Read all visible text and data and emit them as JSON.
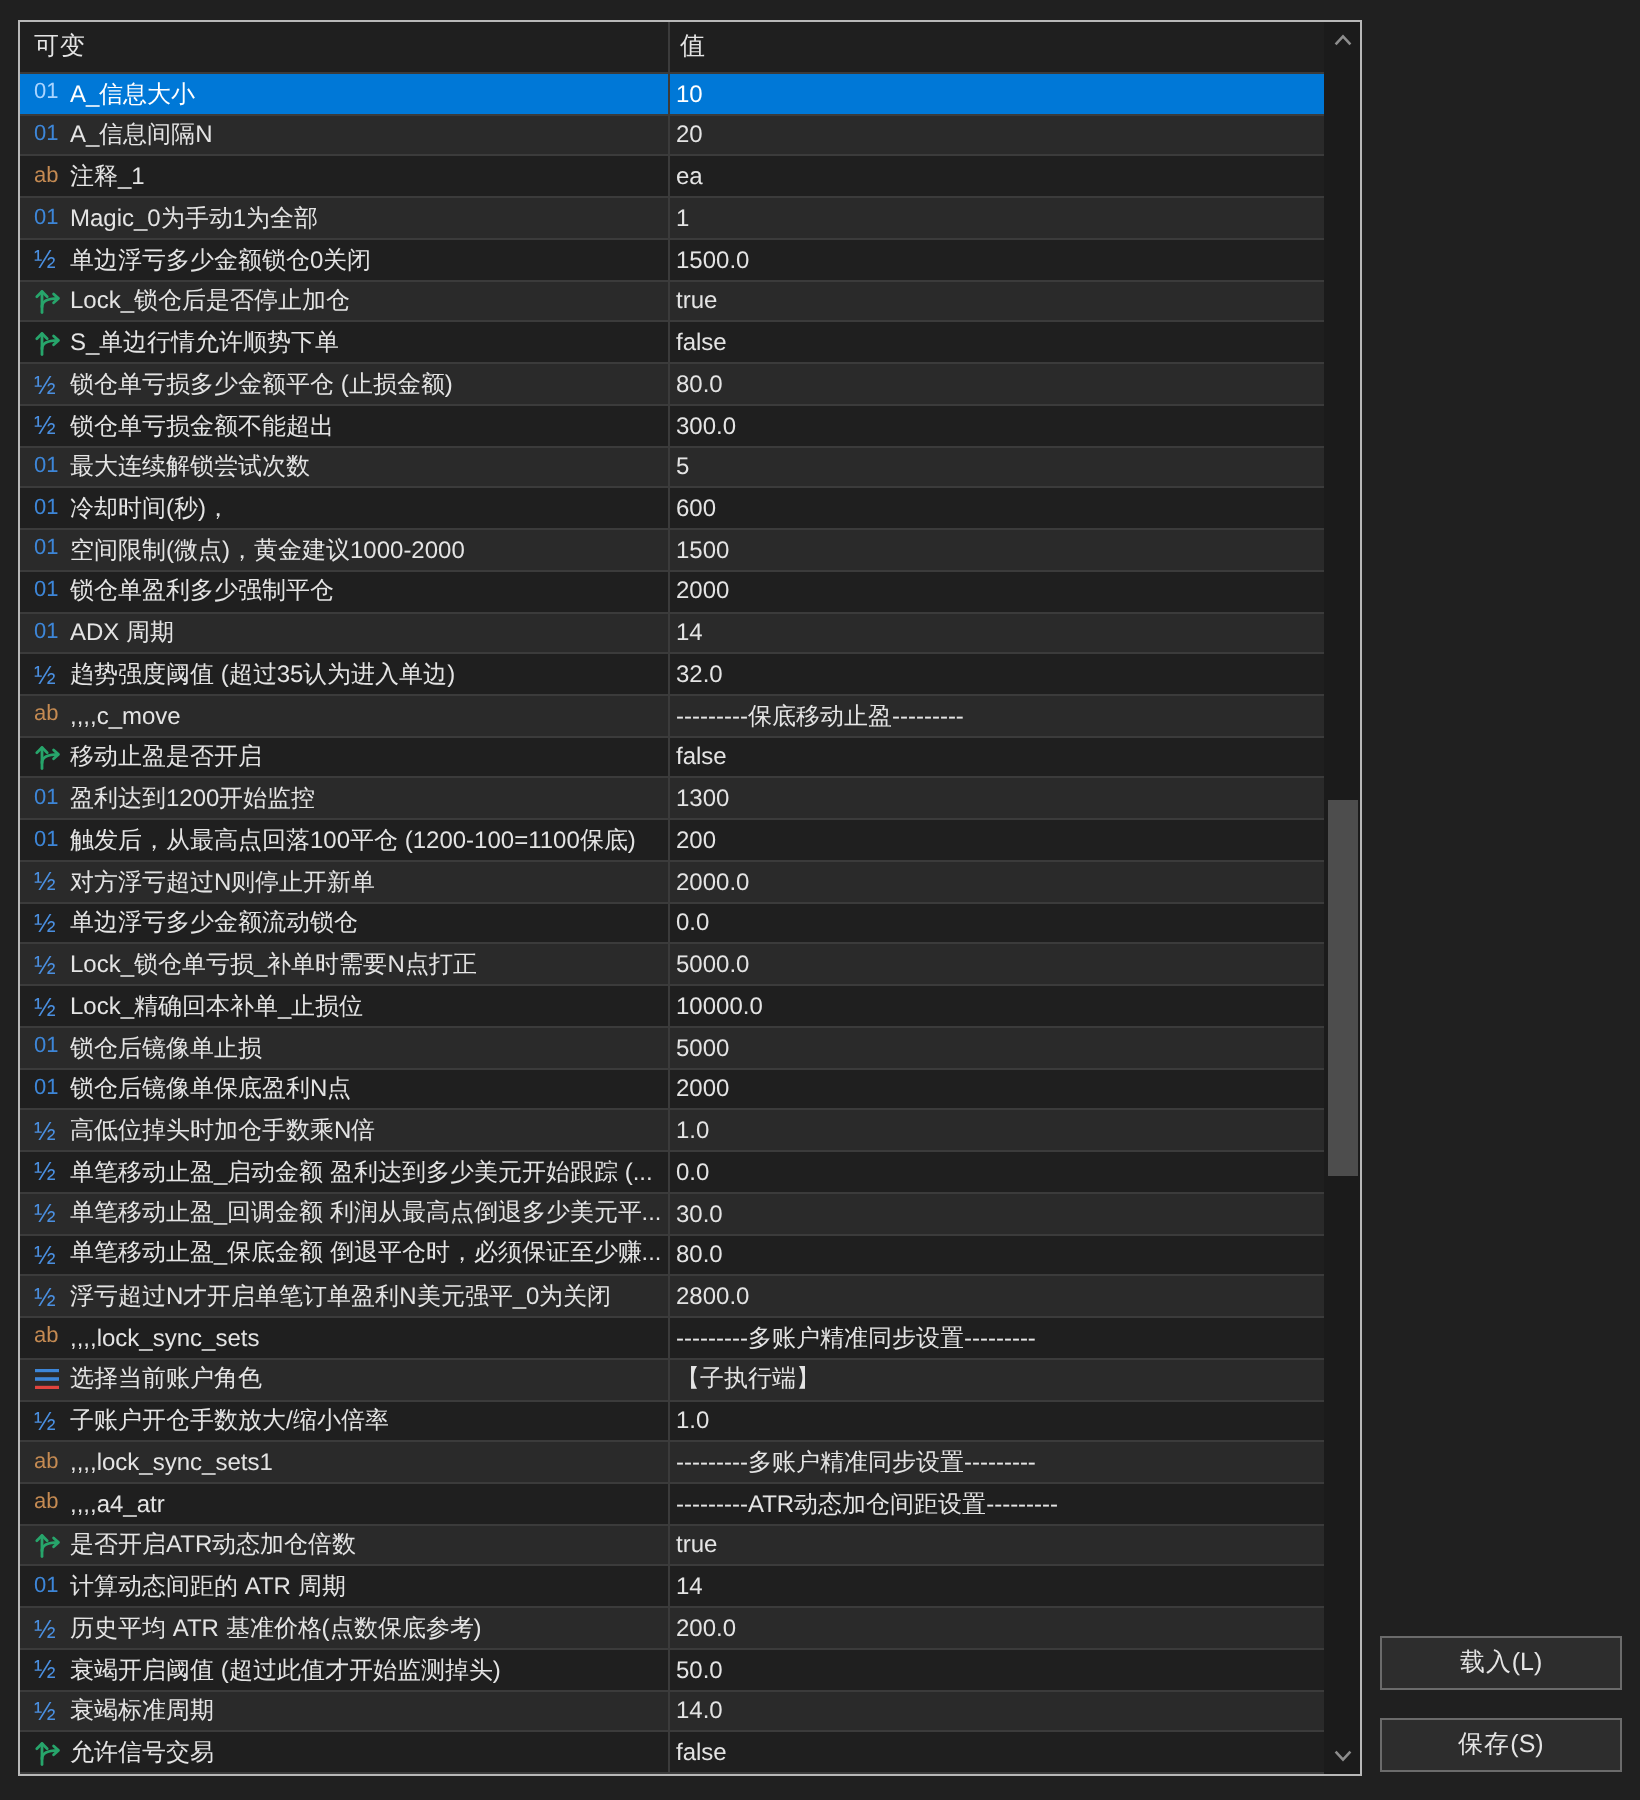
{
  "table": {
    "columns": [
      "可变",
      "值"
    ],
    "rows": [
      {
        "kind": "int",
        "icon": "01",
        "name": "A_信息大小",
        "value": "10",
        "selected": true
      },
      {
        "kind": "int",
        "icon": "01",
        "name": "A_信息间隔N",
        "value": "20",
        "selected": false
      },
      {
        "kind": "string",
        "icon": "ab",
        "name": "注释_1",
        "value": "ea",
        "selected": false
      },
      {
        "kind": "int",
        "icon": "01",
        "name": "Magic_0为手动1为全部",
        "value": "1",
        "selected": false
      },
      {
        "kind": "double",
        "icon": "½",
        "name": "单边浮亏多少金额锁仓0关闭",
        "value": "1500.0",
        "selected": false
      },
      {
        "kind": "bool",
        "name": "Lock_锁仓后是否停止加仓",
        "value": "true",
        "selected": false
      },
      {
        "kind": "bool",
        "name": "S_单边行情允许顺势下单",
        "value": "false",
        "selected": false
      },
      {
        "kind": "double",
        "icon": "½",
        "name": "锁仓单亏损多少金额平仓 (止损金额)",
        "value": "80.0",
        "selected": false
      },
      {
        "kind": "double",
        "icon": "½",
        "name": "锁仓单亏损金额不能超出",
        "value": "300.0",
        "selected": false
      },
      {
        "kind": "int",
        "icon": "01",
        "name": "最大连续解锁尝试次数",
        "value": "5",
        "selected": false
      },
      {
        "kind": "int",
        "icon": "01",
        "name": "冷却时间(秒)，",
        "value": "600",
        "selected": false
      },
      {
        "kind": "int",
        "icon": "01",
        "name": "空间限制(微点)，黄金建议1000-2000",
        "value": "1500",
        "selected": false
      },
      {
        "kind": "int",
        "icon": "01",
        "name": "锁仓单盈利多少强制平仓",
        "value": "2000",
        "selected": false
      },
      {
        "kind": "int",
        "icon": "01",
        "name": "ADX 周期",
        "value": "14",
        "selected": false
      },
      {
        "kind": "double",
        "icon": "½",
        "name": "趋势强度阈值 (超过35认为进入单边)",
        "value": "32.0",
        "selected": false
      },
      {
        "kind": "string",
        "icon": "ab",
        "name": ",,,,c_move",
        "value": "---------保底移动止盈---------",
        "selected": false
      },
      {
        "kind": "bool",
        "name": "移动止盈是否开启",
        "value": "false",
        "selected": false
      },
      {
        "kind": "int",
        "icon": "01",
        "name": "盈利达到1200开始监控",
        "value": "1300",
        "selected": false
      },
      {
        "kind": "int",
        "icon": "01",
        "name": "触发后，从最高点回落100平仓 (1200-100=1100保底)",
        "value": "200",
        "selected": false
      },
      {
        "kind": "double",
        "icon": "½",
        "name": "对方浮亏超过N则停止开新单",
        "value": "2000.0",
        "selected": false
      },
      {
        "kind": "double",
        "icon": "½",
        "name": "单边浮亏多少金额流动锁仓",
        "value": "0.0",
        "selected": false
      },
      {
        "kind": "double",
        "icon": "½",
        "name": "Lock_锁仓单亏损_补单时需要N点打正",
        "value": "5000.0",
        "selected": false
      },
      {
        "kind": "double",
        "icon": "½",
        "name": "Lock_精确回本补单_止损位",
        "value": "10000.0",
        "selected": false
      },
      {
        "kind": "int",
        "icon": "01",
        "name": "锁仓后镜像单止损",
        "value": "5000",
        "selected": false
      },
      {
        "kind": "int",
        "icon": "01",
        "name": "锁仓后镜像单保底盈利N点",
        "value": "2000",
        "selected": false
      },
      {
        "kind": "double",
        "icon": "½",
        "name": "高低位掉头时加仓手数乘N倍",
        "value": "1.0",
        "selected": false
      },
      {
        "kind": "double",
        "icon": "½",
        "name": "单笔移动止盈_启动金额 盈利达到多少美元开始跟踪 (...",
        "value": "0.0",
        "selected": false
      },
      {
        "kind": "double",
        "icon": "½",
        "name": "单笔移动止盈_回调金额 利润从最高点倒退多少美元平...",
        "value": "30.0",
        "selected": false
      },
      {
        "kind": "double",
        "icon": "½",
        "name": "单笔移动止盈_保底金额 倒退平仓时，必须保证至少赚...",
        "value": "80.0",
        "selected": false
      },
      {
        "kind": "double",
        "icon": "½",
        "name": "浮亏超过N才开启单笔订单盈利N美元强平_0为关闭",
        "value": "2800.0",
        "selected": false
      },
      {
        "kind": "string",
        "icon": "ab",
        "name": ",,,,lock_sync_sets",
        "value": "---------多账户精准同步设置---------",
        "selected": false
      },
      {
        "kind": "enum",
        "name": "选择当前账户角色",
        "value": "【子执行端】",
        "selected": false
      },
      {
        "kind": "double",
        "icon": "½",
        "name": "子账户开仓手数放大/缩小倍率",
        "value": "1.0",
        "selected": false
      },
      {
        "kind": "string",
        "icon": "ab",
        "name": ",,,,lock_sync_sets1",
        "value": "---------多账户精准同步设置---------",
        "selected": false
      },
      {
        "kind": "string",
        "icon": "ab",
        "name": ",,,,a4_atr",
        "value": "---------ATR动态加仓间距设置---------",
        "selected": false
      },
      {
        "kind": "bool",
        "name": "是否开启ATR动态加仓倍数",
        "value": "true",
        "selected": false
      },
      {
        "kind": "int",
        "icon": "01",
        "name": "计算动态间距的 ATR 周期",
        "value": "14",
        "selected": false
      },
      {
        "kind": "double",
        "icon": "½",
        "name": "历史平均 ATR 基准价格(点数保底参考)",
        "value": "200.0",
        "selected": false
      },
      {
        "kind": "double",
        "icon": "½",
        "name": "衰竭开启阈值 (超过此值才开始监测掉头)",
        "value": "50.0",
        "selected": false
      },
      {
        "kind": "double",
        "icon": "½",
        "name": "衰竭标准周期",
        "value": "14.0",
        "selected": false
      },
      {
        "kind": "bool",
        "name": "允许信号交易",
        "value": "false",
        "selected": false
      }
    ]
  },
  "buttons": [
    {
      "label": "载入(L)"
    },
    {
      "label": "保存(S)"
    }
  ]
}
